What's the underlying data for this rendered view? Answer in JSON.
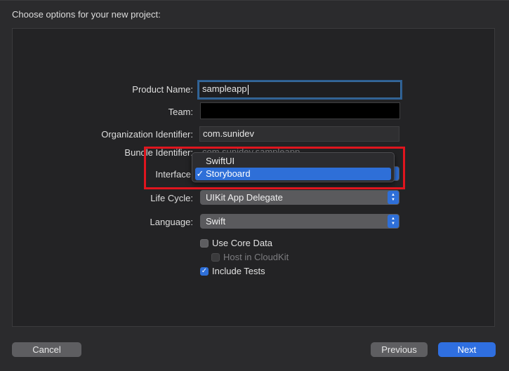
{
  "header": {
    "title": "Choose options for your new project:"
  },
  "form": {
    "product_name": {
      "label": "Product Name:",
      "value": "sampleapp"
    },
    "team": {
      "label": "Team:",
      "value": ""
    },
    "organization_identifier": {
      "label": "Organization Identifier:",
      "value": "com.sunidev"
    },
    "bundle_identifier": {
      "label": "Bundle Identifier:",
      "value": "com.sunidev.sampleapp"
    },
    "interface": {
      "label": "Interface"
    },
    "life_cycle": {
      "label": "Life Cycle:",
      "value": "UIKit App Delegate"
    },
    "language": {
      "label": "Language:",
      "value": "Swift"
    },
    "use_core_data": {
      "label": "Use Core Data",
      "checked": false
    },
    "host_in_cloudkit": {
      "label": "Host in CloudKit",
      "checked": false,
      "disabled": true
    },
    "include_tests": {
      "label": "Include Tests",
      "checked": true
    }
  },
  "interface_menu": {
    "items": [
      {
        "label": "SwiftUI",
        "selected": false
      },
      {
        "label": "Storyboard",
        "selected": true
      }
    ],
    "check_glyph": "✓"
  },
  "buttons": {
    "cancel": "Cancel",
    "previous": "Previous",
    "next": "Next"
  },
  "colors": {
    "accent": "#2f6fe0",
    "highlight_box": "#e0151e",
    "background": "#2b2b2d"
  }
}
